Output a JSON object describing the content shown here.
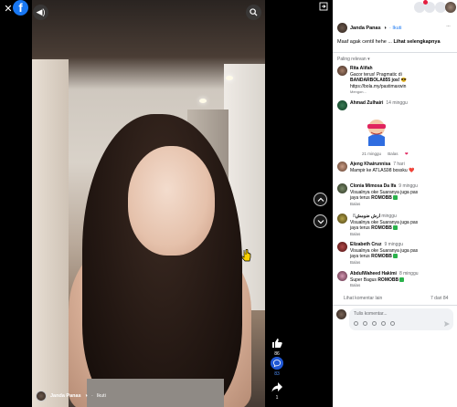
{
  "video": {
    "author_name": "Janda Panas",
    "follow_label": "Ikuti",
    "likes_count": "86",
    "comments_count": "83",
    "shares_count": "1"
  },
  "post": {
    "author_name": "Janda Panas",
    "follow_label": "· Ikuti",
    "caption_text": "Maaf agak centil hehe ...",
    "see_more_label": "Lihat selengkapnya",
    "more_label": "···"
  },
  "comments_section": {
    "sort_label": "Paling relevan ▾",
    "more_comments_label": "Lihat komentar lain",
    "count_label": "7 dari 84",
    "placeholder": "Tulis komentar..."
  },
  "comments": [
    {
      "name": "Rita Alifah",
      "line1": "Gacor terus! Pragmatic di",
      "line2": "BANDARBOLA855 jos! 😎",
      "line3": "https://bola.my/pastimaxwin",
      "line4": "Mengon..."
    },
    {
      "name": "Ahmad Zulhairi",
      "time": "14 minggu"
    },
    {
      "time": "21 minggu",
      "reply": "Balas"
    },
    {
      "name": "Ajeng Khairunnisa",
      "time": "7 hari",
      "text": "Mampir ke ATLAS98 bossku ❤️"
    },
    {
      "name": "Clonia Mimosa Da Ifa",
      "time": "9 minggu",
      "text1": "Visualnya oke Suaranya juga pas",
      "text2": "jaya terus",
      "tag": "ROMOBB"
    },
    {
      "name": "ارش ضومش",
      "time": "8 minggu",
      "text1": "Visualnya oke Suaranya juga pas",
      "text2": "jaya terus",
      "tag": "ROMOBB"
    },
    {
      "name": "Elizabeth Cruz",
      "time": "9 minggu",
      "text1": "Visualnya oke Suaranya juga pas",
      "text2": "jaya terus",
      "tag": "ROMOBB"
    },
    {
      "name": "AbdulWaheed Hakimi",
      "time": "8 minggu",
      "text": "Super Bagus",
      "tag": "ROMOBB"
    }
  ],
  "actions": {
    "reply": "Balas"
  },
  "colors": {
    "accent": "#1877f2",
    "panel_bg": "#ffffff",
    "comment_bubble": "#f0f2f5"
  }
}
